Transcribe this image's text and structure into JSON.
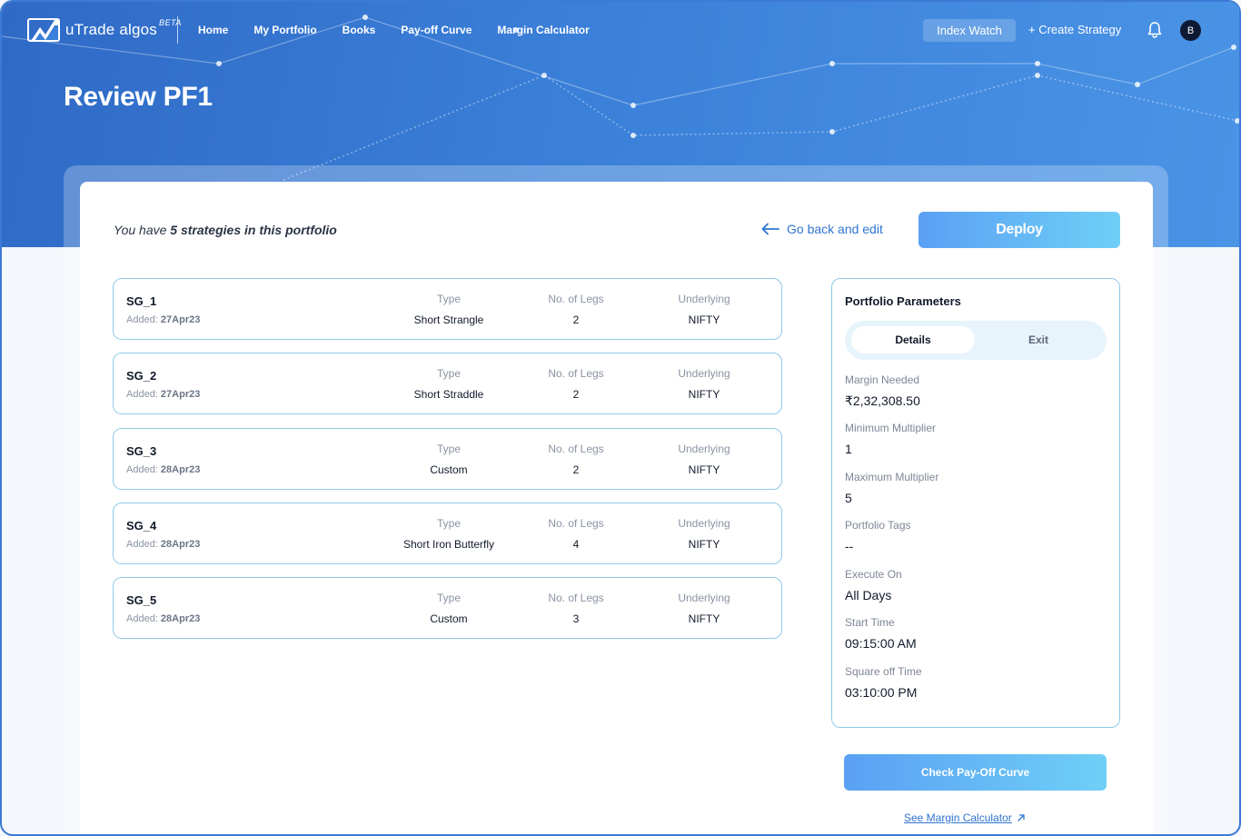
{
  "nav": {
    "logo_text": "uTrade algos",
    "logo_badge": "BETA",
    "links": [
      "Home",
      "My Portfolio",
      "Books",
      "Pay-off Curve",
      "Margin Calculator"
    ],
    "index_watch": "Index Watch",
    "create_strategy": "+ Create Strategy",
    "avatar_initial": "B"
  },
  "page": {
    "title": "Review PF1"
  },
  "summary": {
    "prefix": "You have ",
    "count_text": "5 strategies in this portfolio"
  },
  "actions": {
    "back_edit": "Go back and edit",
    "deploy": "Deploy"
  },
  "strategy_columns": {
    "type": "Type",
    "legs": "No. of Legs",
    "underlying": "Underlying",
    "added_prefix": "Added: "
  },
  "strategies": [
    {
      "name": "SG_1",
      "added": "27Apr23",
      "type": "Short Strangle",
      "legs": "2",
      "underlying": "NIFTY"
    },
    {
      "name": "SG_2",
      "added": "27Apr23",
      "type": "Short Straddle",
      "legs": "2",
      "underlying": "NIFTY"
    },
    {
      "name": "SG_3",
      "added": "28Apr23",
      "type": "Custom",
      "legs": "2",
      "underlying": "NIFTY"
    },
    {
      "name": "SG_4",
      "added": "28Apr23",
      "type": "Short Iron Butterfly",
      "legs": "4",
      "underlying": "NIFTY"
    },
    {
      "name": "SG_5",
      "added": "28Apr23",
      "type": "Custom",
      "legs": "3",
      "underlying": "NIFTY"
    }
  ],
  "params": {
    "title": "Portfolio Parameters",
    "tabs": {
      "active": "Details",
      "other": "Exit"
    },
    "items": [
      {
        "label": "Margin Needed",
        "value": "₹2,32,308.50"
      },
      {
        "label": "Minimum Multiplier",
        "value": "1"
      },
      {
        "label": "Maximum Multiplier",
        "value": "5"
      },
      {
        "label": "Portfolio Tags",
        "value": "--"
      },
      {
        "label": "Execute On",
        "value": "All Days"
      },
      {
        "label": "Start Time",
        "value": "09:15:00 AM"
      },
      {
        "label": "Square off Time",
        "value": "03:10:00 PM"
      }
    ]
  },
  "footer": {
    "payoff_button": "Check Pay-Off Curve",
    "margin_link": "See Margin Calculator"
  },
  "colors": {
    "brand_blue": "#2f74d0",
    "card_border": "#8fcbe8",
    "button_gradient_start": "#5aa0f4",
    "button_gradient_end": "#6fcff6"
  }
}
